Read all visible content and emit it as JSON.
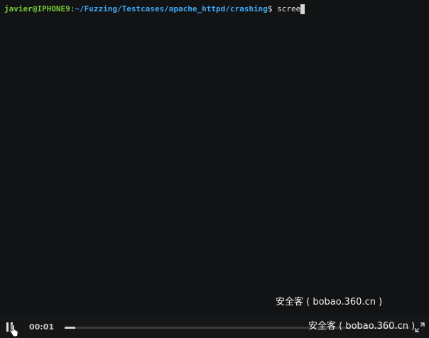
{
  "terminal": {
    "prompt_user": "javier@IPHONE9",
    "prompt_colon": ":",
    "prompt_path": "~/Fuzzing/Testcases/apache_httpd/crashing",
    "prompt_dollar": "$ ",
    "command_text": "scree"
  },
  "watermark": {
    "text": "安全客 ( bobao.360.cn )"
  },
  "player": {
    "elapsed_time": "00:01",
    "progress_fraction": 0.03,
    "icons": {
      "pause": "pause-icon",
      "pointer": "hand-pointer-icon",
      "fullscreen": "fullscreen-icon"
    }
  },
  "colors": {
    "background": "#121314",
    "prompt_user": "#73c936",
    "prompt_path": "#3fa9f5",
    "text": "#e6e6e6"
  }
}
